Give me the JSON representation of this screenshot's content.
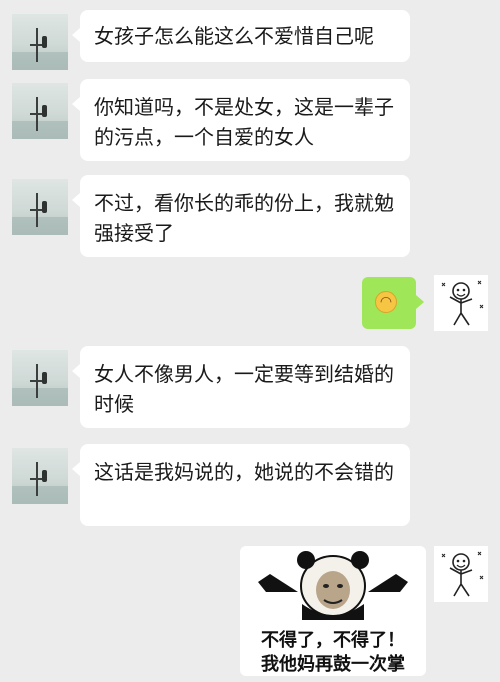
{
  "messages": [
    {
      "text": "女孩子怎么能这么不爱惜自己呢"
    },
    {
      "text": "你知道吗，不是处女，这是一辈子的污点，一个自爱的女人"
    },
    {
      "text": "不过，看你长的乖的份上，我就勉强接受了"
    },
    {
      "text": "女人不像男人，一定要等到结婚的时候"
    },
    {
      "text": "这话是我妈说的，她说的不会错的"
    }
  ],
  "me": {
    "emoji": "smiley-emoji",
    "sticker": {
      "line1": "不得了，不得了！",
      "line2": "我他妈再鼓一次掌"
    }
  },
  "colors": {
    "background": "#ececec",
    "incoming_bubble": "#ffffff",
    "outgoing_bubble": "#9fe658"
  },
  "icons": {
    "left_avatar": "lake-fisherman-avatar",
    "right_avatar": "doodle-stickman-avatar",
    "sticker": "panda-meme-sticker"
  }
}
